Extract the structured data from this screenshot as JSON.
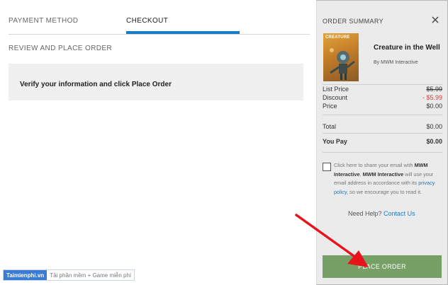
{
  "tabs": {
    "payment": "PAYMENT METHOD",
    "checkout": "CHECKOUT"
  },
  "review": {
    "title": "REVIEW AND PLACE ORDER",
    "verify": "Verify your information and click Place Order"
  },
  "watermark": {
    "brand": "Taimienphi.vn",
    "tagline": "Tải phần mềm + Game miễn phí"
  },
  "summary": {
    "title": "ORDER SUMMARY",
    "cover_text": "CREATURE",
    "game_title": "Creature in the Well",
    "publisher": "By MWM Interactive",
    "list_price_label": "List Price",
    "list_price": "$5.99",
    "discount_label": "Discount",
    "discount": "- $5.99",
    "price_label": "Price",
    "price": "$0.00",
    "total_label": "Total",
    "total": "$0.00",
    "you_pay_label": "You Pay",
    "you_pay": "$0.00"
  },
  "consent": {
    "part1": "Click here to share your email with ",
    "company1": "MWM Interactive",
    "part2": ". ",
    "company2": "MWM Interactive",
    "part3": " will use your email address in accordance with its ",
    "link": "privacy policy",
    "part4": ", so we encourage you to read it."
  },
  "help": {
    "text": "Need Help? ",
    "link": "Contact Us"
  },
  "actions": {
    "place_order": "PLACE ORDER"
  },
  "colors": {
    "tab_active": "#1a7bc4",
    "place_order_bg": "#76a065",
    "discount": "#d23c3c",
    "annotation_arrow": "#e8141b"
  },
  "icons": {
    "close": "close-icon",
    "arrow": "red-arrow-annotation"
  }
}
